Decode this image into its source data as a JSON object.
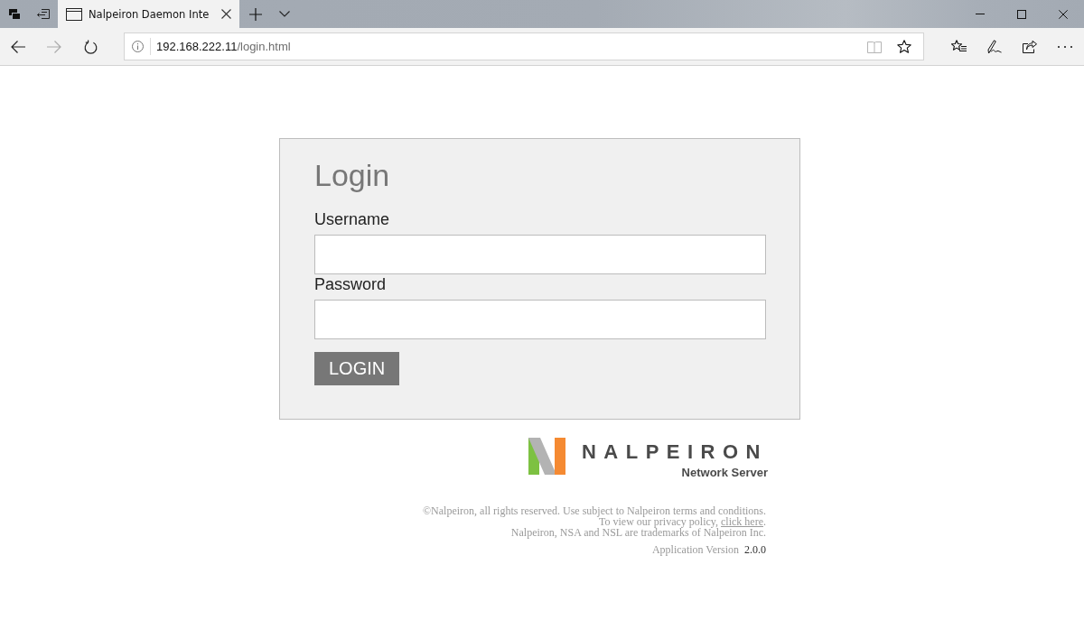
{
  "browser": {
    "tabs": [
      {
        "title": "Nalpeiron Daemon Inte",
        "selected": true
      }
    ],
    "nav": [
      {
        "kind": "back",
        "disabled": false
      },
      {
        "kind": "forward",
        "disabled": true
      },
      {
        "kind": "refresh",
        "disabled": false
      }
    ],
    "address": {
      "host": "192.168.222.11",
      "path": "/login.html"
    }
  },
  "login": {
    "title": "Login",
    "fields": [
      {
        "label": "Username"
      },
      {
        "label": "Password"
      }
    ],
    "button": "LOGIN"
  },
  "logo": {
    "wordmark": "NALPEIRON",
    "subtitle": "Network Server"
  },
  "footer": {
    "lines": [
      {
        "text": "©Nalpeiron, all rights reserved. Use subject to Nalpeiron terms and conditions."
      },
      {
        "text": "To view our privacy policy, ",
        "link": "click here",
        "after": "."
      },
      {
        "text": "Nalpeiron, NSA and NSL are trademarks of Nalpeiron Inc."
      }
    ],
    "version": {
      "label": "Application Version",
      "value": "2.0.0"
    }
  }
}
